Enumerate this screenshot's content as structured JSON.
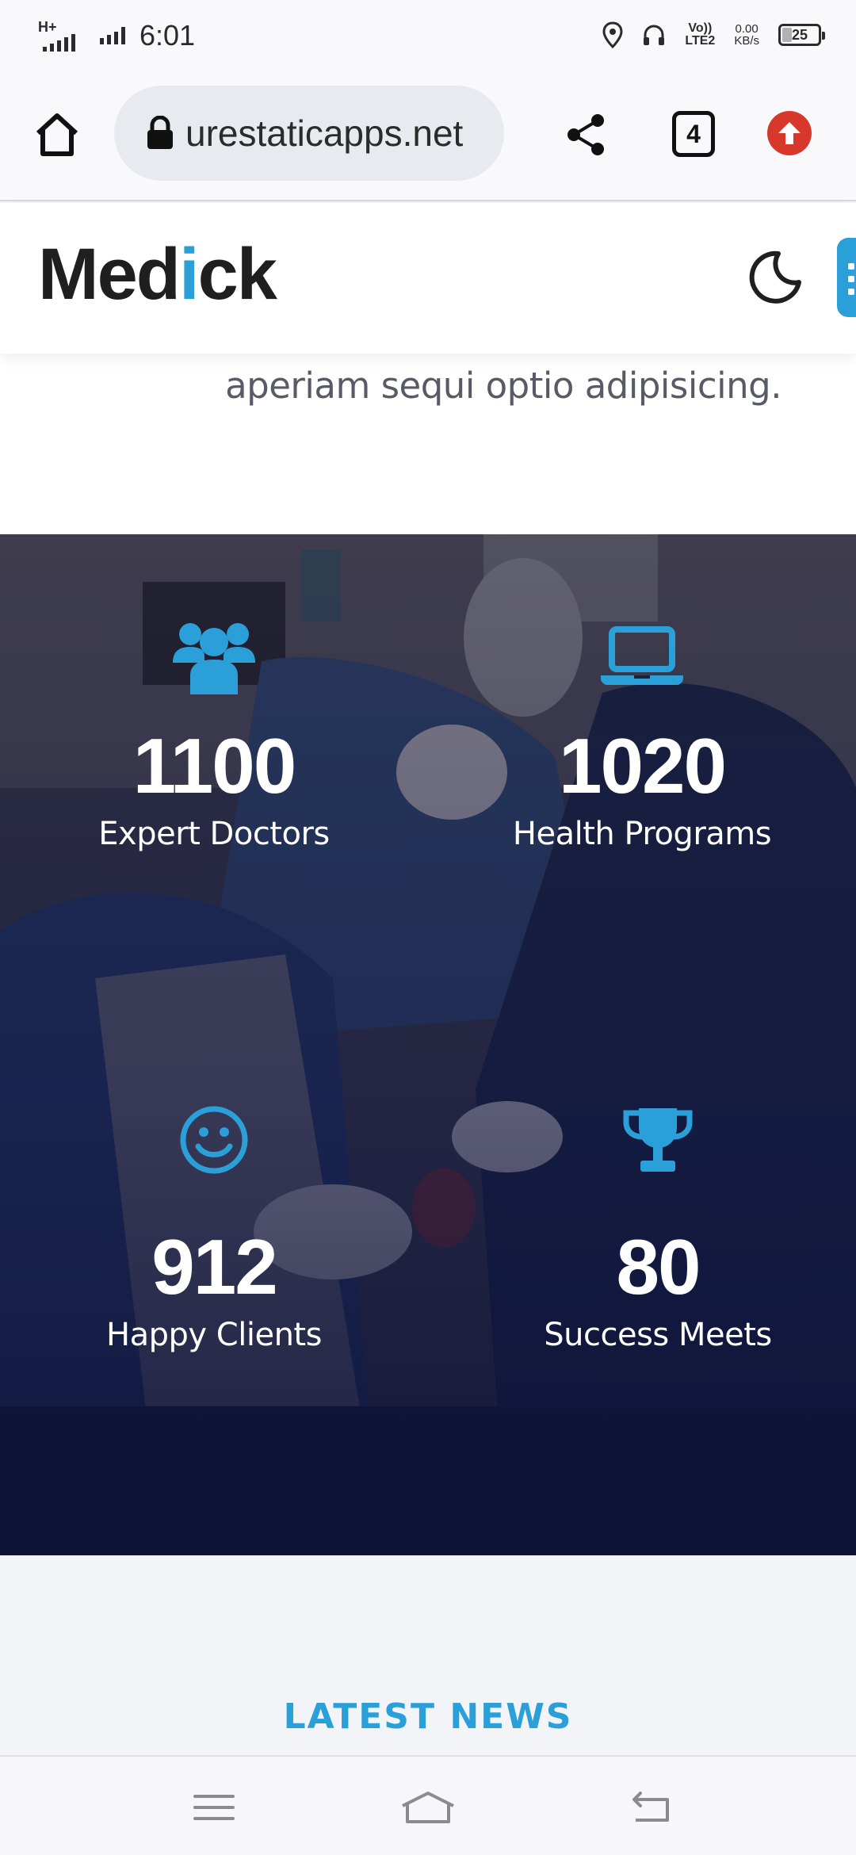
{
  "status_bar": {
    "network_type": "H+",
    "time": "6:01",
    "volte_line1": "Vo))",
    "volte_line2": "LTE2",
    "data_rate": "0.00",
    "data_unit": "KB/s",
    "battery": "25"
  },
  "browser": {
    "url": "urestaticapps.net",
    "tab_count": "4"
  },
  "site": {
    "logo_pre": "Med",
    "logo_accent": "i",
    "logo_post": "ck",
    "intro_text": "aperiam sequi optio adipisicing.",
    "accent_color": "#2a9fd8"
  },
  "stats": [
    {
      "icon": "users-icon",
      "number": "1100",
      "label": "Expert Doctors"
    },
    {
      "icon": "laptop-icon",
      "number": "1020",
      "label": "Health Programs"
    },
    {
      "icon": "smile-icon",
      "number": "912",
      "label": "Happy Clients"
    },
    {
      "icon": "trophy-icon",
      "number": "80",
      "label": "Success Meets"
    }
  ],
  "news": {
    "title": "LATEST NEWS"
  }
}
